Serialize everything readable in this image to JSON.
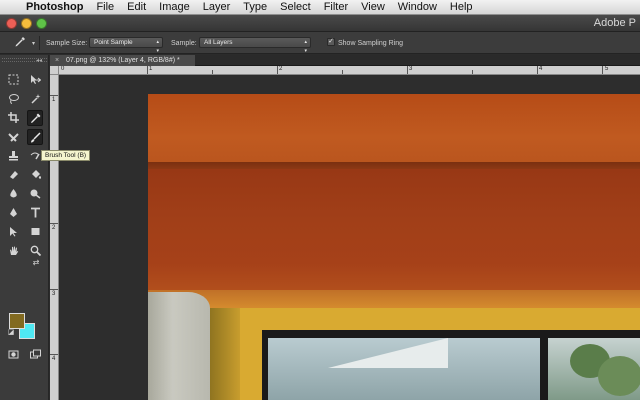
{
  "menubar": {
    "apple_icon": "apple-icon",
    "app_name": "Photoshop",
    "items": [
      "File",
      "Edit",
      "Image",
      "Layer",
      "Type",
      "Select",
      "Filter",
      "View",
      "Window",
      "Help"
    ]
  },
  "window": {
    "title": "Adobe P",
    "traffic_colors": [
      "#ec5f56",
      "#f5bd3c",
      "#5fc348"
    ]
  },
  "options": {
    "tool_icon": "eyedropper-icon",
    "sample_size_label": "Sample Size:",
    "sample_size_value": "Point Sample",
    "sample_label": "Sample:",
    "sample_value": "All Layers",
    "show_ring_checked": "✓",
    "show_ring_label": "Show Sampling Ring"
  },
  "document": {
    "tab_title": "07.png @ 132% (Layer 4, RGB/8#) *",
    "close_glyph": "×"
  },
  "rulers": {
    "h_labels": [
      "0",
      "1",
      "2",
      "3",
      "4",
      "5"
    ],
    "v_labels": [
      "1",
      "2",
      "3",
      "4"
    ]
  },
  "tools": {
    "tooltip": "Brush Tool (B)",
    "active": "eyedropper-tool",
    "foreground_color": "#826a20",
    "background_color": "#4fe9f3"
  }
}
